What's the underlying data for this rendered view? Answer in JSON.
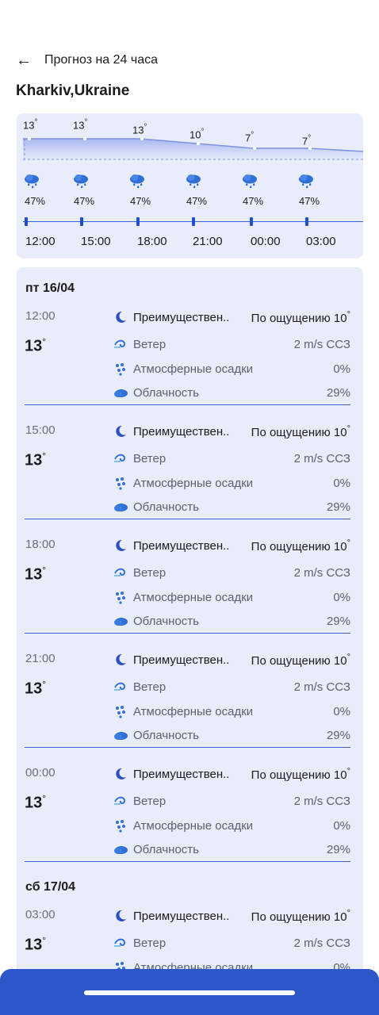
{
  "header": {
    "back_icon": "arrow-left-icon",
    "title": "Прогноз на 24 часа"
  },
  "city": "Kharkiv,Ukraine",
  "chart_data": {
    "type": "line",
    "x": [
      "12:00",
      "15:00",
      "18:00",
      "21:00",
      "00:00",
      "03:00"
    ],
    "temps": [
      "13",
      "13",
      "13",
      "10",
      "7",
      "7"
    ],
    "values": [
      13,
      13,
      13,
      10,
      7,
      7
    ],
    "precip": [
      "47%",
      "47%",
      "47%",
      "47%",
      "47%",
      "47%"
    ],
    "degree": "°",
    "precip_icon": "rain-cloud-icon",
    "accent": "#1f4fd0"
  },
  "list": {
    "days": [
      {
        "label": "пт 16/04",
        "entries": [
          {
            "time": "12:00",
            "temp": "13",
            "condition": "Преимуществен..",
            "feels": "По ощущению 10"
          },
          {
            "time": "15:00",
            "temp": "13",
            "condition": "Преимуществен..",
            "feels": "По ощущению 10"
          },
          {
            "time": "18:00",
            "temp": "13",
            "condition": "Преимуществен..",
            "feels": "По ощущению 10"
          },
          {
            "time": "21:00",
            "temp": "13",
            "condition": "Преимуществен..",
            "feels": "По ощущению 10"
          },
          {
            "time": "00:00",
            "temp": "13",
            "condition": "Преимуществен..",
            "feels": "По ощущению 10"
          }
        ]
      },
      {
        "label": "сб 17/04",
        "entries": [
          {
            "time": "03:00",
            "temp": "13",
            "condition": "Преимуществен..",
            "feels": "По ощущению 10"
          }
        ]
      }
    ],
    "wind_label": "Ветер",
    "wind_value": "2 m/s ССЗ",
    "precip_label": "Атмосферные осадки",
    "precip_value": "0%",
    "cloud_label": "Облачность",
    "cloud_value": "29%",
    "degree": "°",
    "icons": {
      "condition": "moon-icon",
      "wind": "wind-icon",
      "precip": "raindrops-icon",
      "cloud": "cloud-icon"
    }
  },
  "nav": {
    "home_indicator": "home-indicator"
  }
}
